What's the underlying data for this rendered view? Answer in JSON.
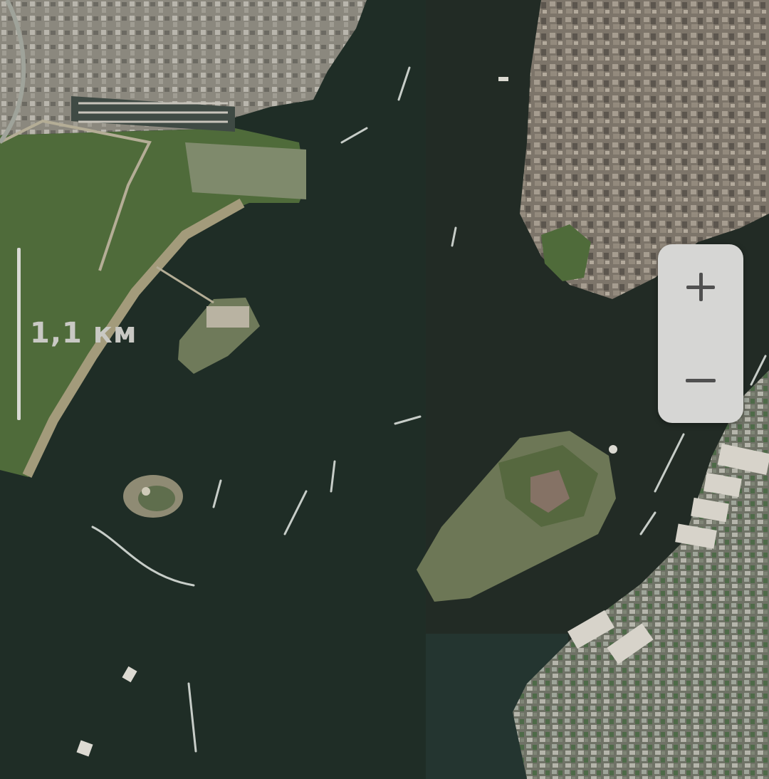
{
  "map": {
    "type": "satellite",
    "scale": {
      "label": "1,1 км"
    },
    "colors": {
      "water": "#1f2d26",
      "land_green": "#4f6b3a",
      "land_urban": "#8a8175",
      "land_sand": "#9a9170",
      "pier": "#c8c4bb"
    }
  },
  "controls": {
    "zoom_in": {
      "icon": "plus-icon"
    },
    "zoom_out": {
      "icon": "minus-icon"
    }
  }
}
